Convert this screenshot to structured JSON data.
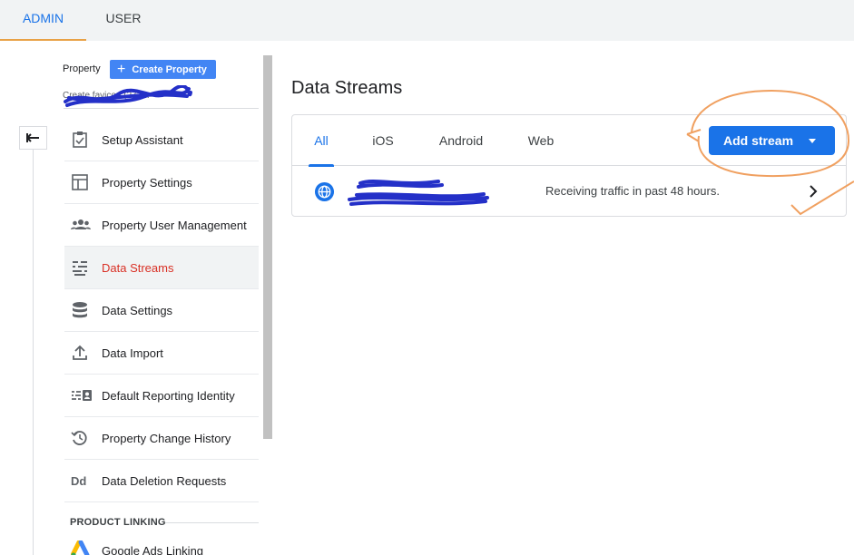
{
  "top_tabs": {
    "admin": "ADMIN",
    "user": "USER"
  },
  "property": {
    "label": "Property",
    "create_button": "Create Property",
    "name_partial": "Create favicon (272..."
  },
  "nav": [
    {
      "label": "Setup Assistant",
      "icon": "checklist-icon"
    },
    {
      "label": "Property Settings",
      "icon": "layout-icon"
    },
    {
      "label": "Property User Management",
      "icon": "people-icon"
    },
    {
      "label": "Data Streams",
      "icon": "streams-icon",
      "active": true
    },
    {
      "label": "Data Settings",
      "icon": "database-icon"
    },
    {
      "label": "Data Import",
      "icon": "upload-icon"
    },
    {
      "label": "Default Reporting Identity",
      "icon": "identity-icon"
    },
    {
      "label": "Property Change History",
      "icon": "history-icon"
    },
    {
      "label": "Data Deletion Requests",
      "icon": "dd-icon"
    }
  ],
  "product_linking": {
    "heading": "PRODUCT LINKING",
    "google_ads": "Google Ads Linking"
  },
  "main": {
    "title": "Data Streams",
    "tabs": [
      "All",
      "iOS",
      "Android",
      "Web"
    ],
    "active_tab": "All",
    "add_stream": "Add stream",
    "stream_status": "Receiving traffic in past 48 hours."
  },
  "colors": {
    "accent_blue": "#1a73e8",
    "active_red": "#d93025",
    "annotation_orange": "#f0a060",
    "scribble_blue": "#2430c8"
  }
}
